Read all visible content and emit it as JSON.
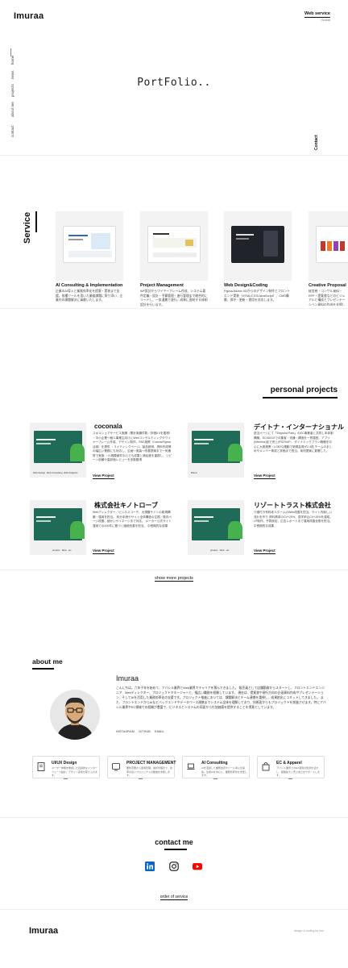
{
  "header": {
    "logo": "Imuraa",
    "web_service_title": "Web service",
    "web_service_sub": "Global"
  },
  "nav": {
    "items": [
      "home",
      "news",
      "projects",
      "about me",
      "contact"
    ],
    "contact_vertical": "Contact"
  },
  "hero": {
    "title": "PortFolio.."
  },
  "service": {
    "label": "Service",
    "cards": [
      {
        "title": "AI Consulting & Implementation",
        "desc": "企業のAI導入と業務効率化を提案・実装まで支援。各種ツールを用いた業務課題に寄り添い、企業内の課題解決に貢献いたします。",
        "screen_color": "#ffffff"
      },
      {
        "title": "Project Management",
        "desc": "WF設計からワイヤーフレーム作成、システム要件定義・設計・予算管理・進行管理まで総合的にリードし、一気通貫で遂行。成果に直結する体制設計を行います。",
        "screen_color": "#ffffff"
      },
      {
        "title": "Web Design&Coding",
        "desc": "Figma/Adobe XDからのデザイン制作とフロントエンド実装（HTML/CSS/JavaScript）、CMS構築、保守・更新・運用を対応します。",
        "screen_color": "#20232a"
      },
      {
        "title": "Creative Proposal",
        "desc": "経営層・コンサル資料・RFP・提案書などのビジュアルと構成とプレゼンテーション資料の作成を支援します。",
        "screen_color": "#ffffff"
      }
    ]
  },
  "projects": {
    "title": "personal projects",
    "items": [
      {
        "name": "coconala",
        "desc": "スキルシェアサービス実績（累計実績件数／評価5.0を獲得）\n・中小企業〜個人事業主向けにWebコンサルティングやワイヤーフレーム作成、デザイン制作、SNS施策（Canva/Figma活用）を提供\n・ライティングページ、製品説明、資料作成等の幅広い業務にも対応し、企画〜実装〜改善提案まで一気通貫で実施\n・小規模案件中心でも成果と満足度を重視し、リピート依頼や高評価レビューを多数獲得",
        "tags": [
          "Web Design",
          "Web Consulting",
          "Web Analytics"
        ],
        "link": "View Project"
      },
      {
        "name": "デイトナ・インターナショナル",
        "desc": "該当ページにて「Daytona Park」のEC事業者と共同し本体制構築。EC/UI/UXでの集客・流通・構造を一貫運営。アプリ(Web/Ios)化で売上が32%UP。\nダイナミックプラン戦略を中心に大胆施策・LGBTQ連動で新規会員が2.4倍\nチームのまとめやメンバー育成と評価まで担当。商材提案に影響した。",
        "tags": [
          "Brand"
        ],
        "link": "View Project"
      },
      {
        "name": "株式会社キノトローブ",
        "desc": "Webディレクター／ビジネスコーチ、大規模サイトの新規構築・運用を担当。\n約分手続やサイト全体構造の注視／既存ページ改善、細かいサイネージまで対応。\nメーカー公式サイト運用での200件に基づく継続改善を担当。\n中長期的な成果",
        "tags": [
          "product",
          "Web",
          "etc"
        ],
        "link": "View Project"
      },
      {
        "name": "リゾートトラスト株式会社",
        "desc": "介護付き有料老人ホームのWeb改善を担当。サイト内新しい流れを作り\n資料請求のCV+20%、見学申込CV+15%を達成。\nLP制作、予算設定、広告レポートまで運用改善全般を担当。\n中長期的な成果",
        "tags": [
          "product",
          "Web",
          "etc"
        ],
        "link": "View Project"
      }
    ],
    "show_more": "show more projects"
  },
  "about": {
    "title": "about me",
    "name": "Imuraa",
    "text": "こんにちは。六年子年を始めて、アパレル業界とWeb業界でキャリアを積んできました。\n販売員として店舗勤務からスタートし、フロントエンドエンジニア、Webディレクター、プロジェクトマネージャーと、幅広い職務を経験しています。\n現在は、提案書や現行方向の企画資料作成やプレゼンテーション、そしてAIを活用した業務効率化の支援です。プロジェクト推進においては、課題解決とチーム連携を重視し、成果創出にコミットしてきました。\nまた、フロントエンドからAIなどバックエンドやデータベース連携までシステム全体を理解しており、技術面からもプロジェクトを前進させます。特にアパレル業界やEC領域での経験が豊富で、ビジネスとシステムの両面から付加価値を提供することを得意としています。",
    "links": [
      "INSTAGRAM",
      "GITHUB",
      "EMAIL"
    ],
    "skills": [
      {
        "title": "UI/UX Design",
        "desc": "ユーザー体験を重視した直感的なインターフェース設計。デザイン思考を取り入れます。"
      },
      {
        "title": "PROJECT MANAGEMENT",
        "desc": "要件定義から運用管理、進捗管理まで、効率の良いプロジェクトの推進を支援します。"
      },
      {
        "title": "AI Consulting",
        "desc": "AIを活用した業務改善やツール導入を提案。生成AIを中心に、業務効率化を支援します。"
      },
      {
        "title": "EC & Apparel",
        "desc": "アパレル業界でのEC運用の知見を活かし、販路拡大と売上向上をサポートします。"
      }
    ]
  },
  "contact": {
    "title": "contact me",
    "socials": [
      "linkedin-icon",
      "instagram-icon",
      "youtube-icon"
    ],
    "order_link": "order of service"
  },
  "footer": {
    "logo": "Imuraa",
    "copy": "design & coding by ime"
  },
  "colors": {
    "linkedin": "#0a66c2",
    "youtube": "#ff0000",
    "project_green": "#1f6b57"
  }
}
